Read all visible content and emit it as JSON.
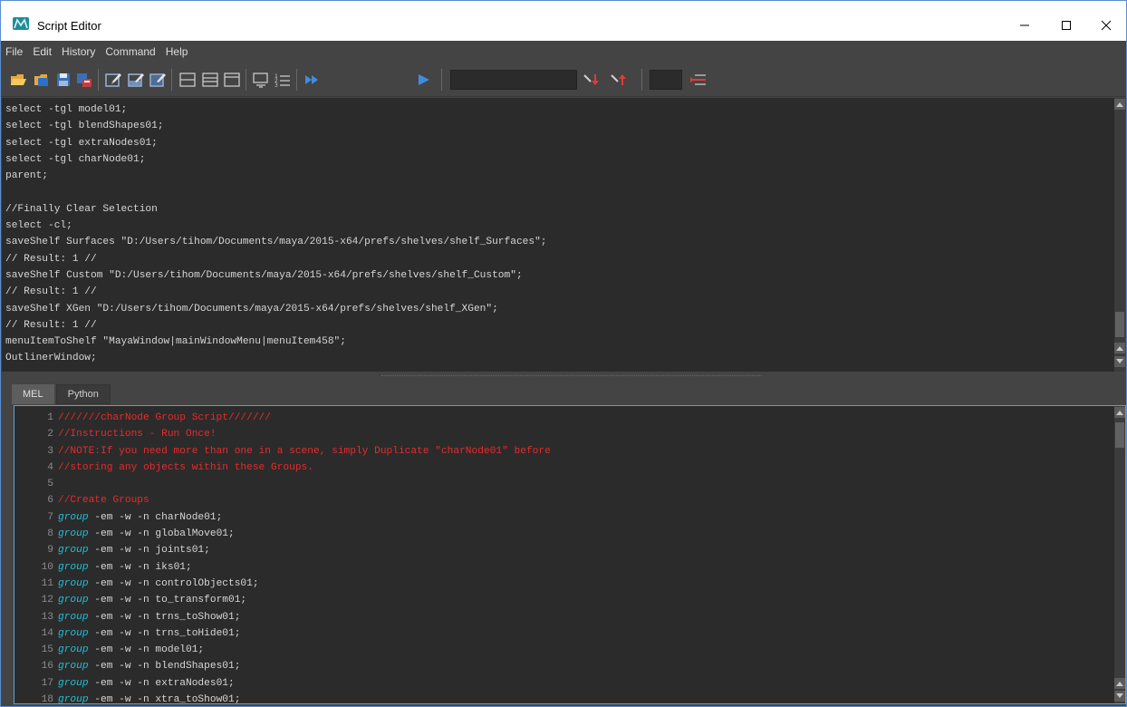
{
  "window": {
    "title": "Script Editor"
  },
  "menubar": {
    "items": [
      "File",
      "Edit",
      "History",
      "Command",
      "Help"
    ]
  },
  "toolbar": {
    "buttons": [
      "open-script-icon",
      "source-script-icon",
      "save-script-icon",
      "save-to-shelf-icon",
      "clear-history-icon",
      "clear-input-icon",
      "clear-all-icon",
      "show-history-icon",
      "show-input-icon",
      "show-both-icon",
      "echo-commands-icon",
      "line-numbers-icon",
      "execute-all-icon",
      "execute-icon",
      "search-down-icon",
      "search-up-icon",
      "goto-line-icon"
    ],
    "search_value": "",
    "line_value": ""
  },
  "output": {
    "lines": [
      "select -tgl model01;",
      "select -tgl blendShapes01;",
      "select -tgl extraNodes01;",
      "select -tgl charNode01;",
      "parent;",
      "",
      "//Finally Clear Selection",
      "select -cl;",
      "saveShelf Surfaces \"D:/Users/tihom/Documents/maya/2015-x64/prefs/shelves/shelf_Surfaces\";",
      "// Result: 1 //",
      "saveShelf Custom \"D:/Users/tihom/Documents/maya/2015-x64/prefs/shelves/shelf_Custom\";",
      "// Result: 1 //",
      "saveShelf XGen \"D:/Users/tihom/Documents/maya/2015-x64/prefs/shelves/shelf_XGen\";",
      "// Result: 1 //",
      "menuItemToShelf \"MayaWindow|mainWindowMenu|menuItem458\";",
      "OutlinerWindow;"
    ]
  },
  "tabs": [
    {
      "label": "MEL",
      "active": true
    },
    {
      "label": "Python",
      "active": false
    }
  ],
  "editor": {
    "lines": [
      {
        "n": "1",
        "kw": "",
        "text": "///////charNode Group Script///////",
        "comment": true
      },
      {
        "n": "2",
        "kw": "",
        "text": "//Instructions - Run Once!",
        "comment": true
      },
      {
        "n": "3",
        "kw": "",
        "text": "//NOTE:If you need more than one in a scene, simply Duplicate \"charNode01\" before",
        "comment": true
      },
      {
        "n": "4",
        "kw": "",
        "text": "//storing any objects within these Groups.",
        "comment": true
      },
      {
        "n": "5",
        "kw": "",
        "text": "",
        "comment": false
      },
      {
        "n": "6",
        "kw": "",
        "text": "//Create Groups",
        "comment": true
      },
      {
        "n": "7",
        "kw": "group",
        "text": " -em -w -n charNode01;",
        "comment": false
      },
      {
        "n": "8",
        "kw": "group",
        "text": " -em -w -n globalMove01;",
        "comment": false
      },
      {
        "n": "9",
        "kw": "group",
        "text": " -em -w -n joints01;",
        "comment": false
      },
      {
        "n": "10",
        "kw": "group",
        "text": " -em -w -n iks01;",
        "comment": false
      },
      {
        "n": "11",
        "kw": "group",
        "text": " -em -w -n controlObjects01;",
        "comment": false
      },
      {
        "n": "12",
        "kw": "group",
        "text": " -em -w -n to_transform01;",
        "comment": false
      },
      {
        "n": "13",
        "kw": "group",
        "text": " -em -w -n trns_toShow01;",
        "comment": false
      },
      {
        "n": "14",
        "kw": "group",
        "text": " -em -w -n trns_toHide01;",
        "comment": false
      },
      {
        "n": "15",
        "kw": "group",
        "text": " -em -w -n model01;",
        "comment": false
      },
      {
        "n": "16",
        "kw": "group",
        "text": " -em -w -n blendShapes01;",
        "comment": false
      },
      {
        "n": "17",
        "kw": "group",
        "text": " -em -w -n extraNodes01;",
        "comment": false
      },
      {
        "n": "18",
        "kw": "group",
        "text": " -em -w -n xtra_toShow01;",
        "comment": false
      }
    ]
  },
  "colors": {
    "comment": "#e82b2b",
    "keyword": "#1fc0d8",
    "text": "#d6d6d6",
    "background": "#2b2b2b",
    "focus_border": "#5a9fd8"
  }
}
